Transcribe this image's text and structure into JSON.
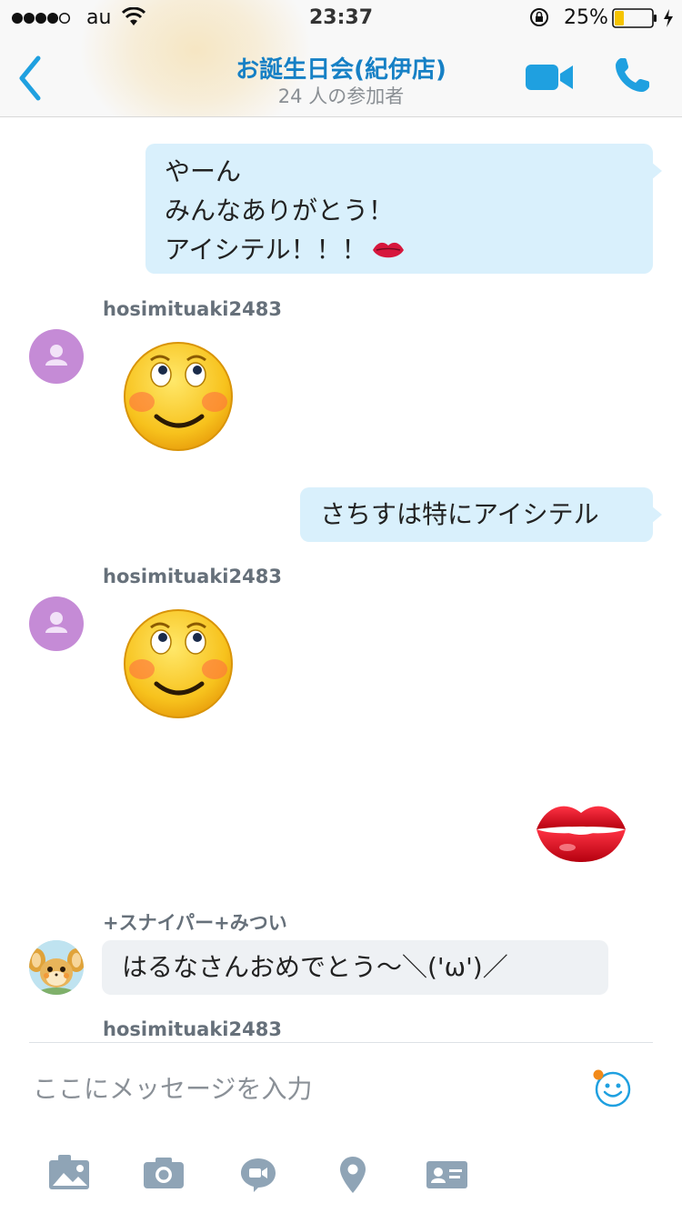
{
  "status_bar": {
    "carrier": "au",
    "time": "23:37",
    "battery": "25%",
    "battery_level": 0.25
  },
  "header": {
    "title": "お誕生日会(紀伊店)",
    "subtitle": "24 人の参加者"
  },
  "messages": {
    "m1": {
      "lines": [
        "やーん",
        "みんなありがとう！",
        "アイシテル！！！"
      ]
    },
    "m2": {
      "sender": "hosimituaki2483"
    },
    "m3": {
      "text": "さちすは特にアイシテル"
    },
    "m4": {
      "sender": "hosimituaki2483"
    },
    "m6": {
      "sender": "+スナイパー+みつい",
      "text": "はるなさんおめでとう～＼('ω')／"
    },
    "m7": {
      "sender": "hosimituaki2483"
    }
  },
  "composer": {
    "placeholder": "ここにメッセージを入力"
  },
  "toolbar": {
    "icons": [
      "photo-icon",
      "camera-icon",
      "video-message-icon",
      "location-icon",
      "contact-card-icon"
    ]
  },
  "colors": {
    "accent": "#1fa0e0",
    "title": "#1680c5",
    "outgoing_bubble": "#d9f0fc",
    "incoming_bubble": "#eef1f4",
    "avatar_purple": "#c58bd6",
    "toolbar_icon": "#8fa4b6"
  }
}
